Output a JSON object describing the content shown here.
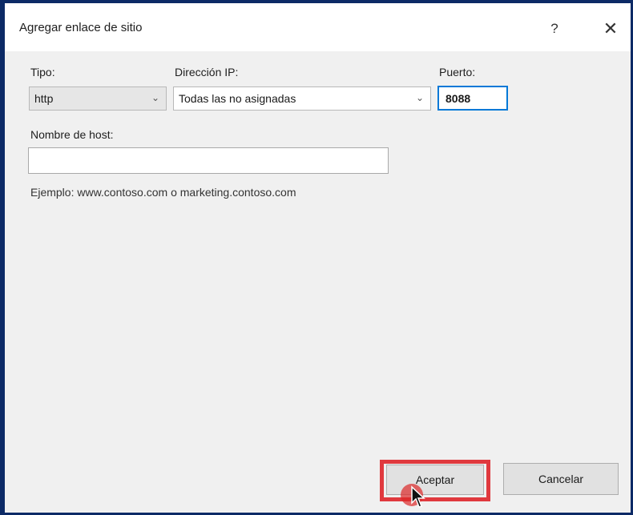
{
  "dialog": {
    "title": "Agregar enlace de sitio",
    "help_label": "?",
    "close_label": "✕"
  },
  "fields": {
    "type_label": "Tipo:",
    "type_value": "http",
    "ip_label": "Dirección IP:",
    "ip_value": "Todas las no asignadas",
    "port_label": "Puerto:",
    "port_value": "8088",
    "host_label": "Nombre de host:",
    "host_value": "",
    "host_example": "Ejemplo: www.contoso.com o marketing.contoso.com"
  },
  "buttons": {
    "accept_label": "Aceptar",
    "cancel_label": "Cancelar"
  },
  "icons": {
    "dropdown": "chevron-down-icon",
    "help": "help-icon",
    "close": "close-icon",
    "cursor": "mouse-pointer-icon"
  },
  "colors": {
    "highlight": "#e0393e",
    "focus": "#0078d7",
    "frame": "#0c2a66"
  }
}
